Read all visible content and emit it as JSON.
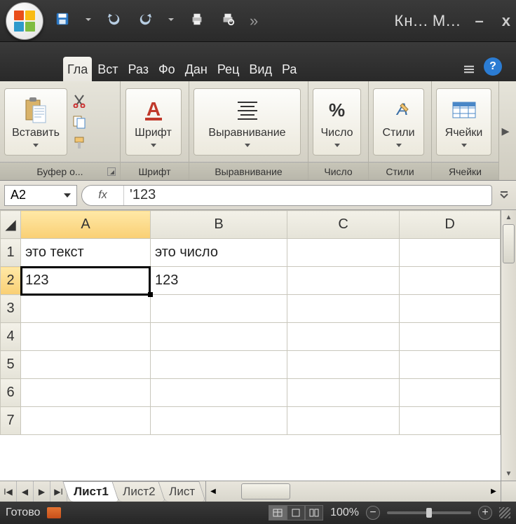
{
  "title": {
    "doc": "Кн...",
    "app_abbr": "M..."
  },
  "window_controls": {
    "minimize": "–",
    "close": "x"
  },
  "qat": {
    "save": "save-icon",
    "undo": "undo-icon",
    "redo": "redo-icon",
    "print": "print-icon",
    "preview": "preview-icon"
  },
  "tabs": [
    "Гла",
    "Вст",
    "Раз",
    "Фо",
    "Дан",
    "Рец",
    "Вид",
    "Ра"
  ],
  "ribbon": {
    "clipboard": {
      "label": "Буфер о...",
      "paste": "Вставить"
    },
    "font": {
      "label": "Шрифт"
    },
    "alignment": {
      "label": "Выравнивание"
    },
    "number": {
      "label": "Число",
      "symbol": "%"
    },
    "styles": {
      "label": "Стили"
    },
    "cells": {
      "label": "Ячейки"
    }
  },
  "namebox": "A2",
  "fx_label": "fx",
  "formula": "'123",
  "columns": [
    "A",
    "B",
    "C",
    "D"
  ],
  "rows": [
    "1",
    "2",
    "3",
    "4",
    "5",
    "6",
    "7"
  ],
  "cells": {
    "A1": "это текст",
    "B1": "это число",
    "A2": "123",
    "B2": "123"
  },
  "selected_cell": "A2",
  "sheet_tabs": [
    "Лист1",
    "Лист2",
    "Лист"
  ],
  "status": {
    "ready": "Готово",
    "zoom": "100%"
  }
}
